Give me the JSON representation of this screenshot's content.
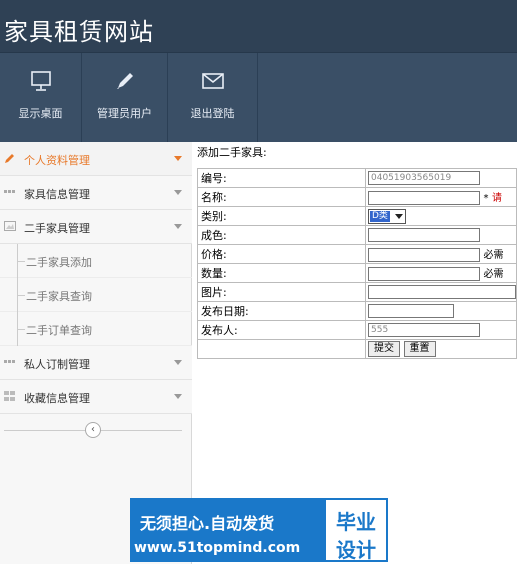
{
  "app": {
    "title": "家具租赁网站"
  },
  "toolbar": {
    "items": [
      {
        "label": "显示桌面",
        "icon": "monitor-icon"
      },
      {
        "label": "管理员用户",
        "icon": "pencil-icon"
      },
      {
        "label": "退出登陆",
        "icon": "envelope-icon"
      }
    ]
  },
  "sidebar": {
    "items": [
      {
        "label": "个人资料管理",
        "active": true,
        "icon": "pencil-icon"
      },
      {
        "label": "家具信息管理",
        "icon": "grid-icon"
      },
      {
        "label": "二手家具管理",
        "icon": "image-icon"
      }
    ],
    "subitems": [
      "二手家具添加",
      "二手家具查询",
      "二手订单查询"
    ],
    "items_lower": [
      {
        "label": "私人订制管理",
        "icon": "grid-icon"
      },
      {
        "label": "收藏信息管理",
        "icon": "grid-icon"
      }
    ],
    "collapse_glyph": "‹"
  },
  "form": {
    "title": "添加二手家具:",
    "fields": {
      "code": {
        "label": "编号:",
        "value": "04051903565019"
      },
      "name": {
        "label": "名称:",
        "value": "",
        "required_mark": "*",
        "hint": "请"
      },
      "category": {
        "label": "类别:",
        "selected": "D类"
      },
      "color": {
        "label": "成色:",
        "value": ""
      },
      "price": {
        "label": "价格:",
        "value": "",
        "hint": "必需"
      },
      "quantity": {
        "label": "数量:",
        "value": "",
        "hint": "必需"
      },
      "image": {
        "label": "图片:",
        "value": ""
      },
      "date": {
        "label": "发布日期:",
        "value": ""
      },
      "publisher": {
        "label": "发布人:",
        "value": "555"
      }
    },
    "submit_label": "提交",
    "reset_label": "重置"
  },
  "watermark": {
    "line1": "无须担心.自动发货",
    "line2": "www.51topmind.com",
    "side1": "毕业",
    "side2": "设计"
  },
  "colors": {
    "header": "#2f4155",
    "toolbar": "#3a4f66",
    "accent": "#e8792a",
    "watermark": "#1a78c9"
  }
}
